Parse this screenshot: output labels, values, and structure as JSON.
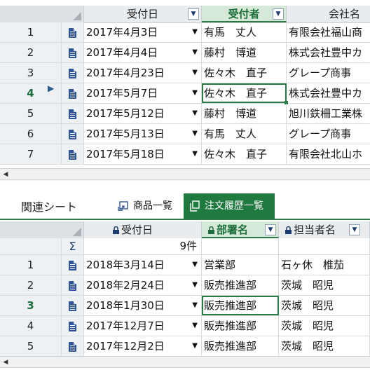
{
  "top_grid": {
    "headers": {
      "date": "受付日",
      "receiver": "受付者",
      "company": "会社名"
    },
    "rows": [
      {
        "num": "1",
        "date": "2017年4月3日",
        "receiver": "有馬　丈人",
        "company": "有限会社福山商"
      },
      {
        "num": "2",
        "date": "2017年4月4日",
        "receiver": "藤村　博道",
        "company": "株式会社豊中カ"
      },
      {
        "num": "3",
        "date": "2017年4月23日",
        "receiver": "佐々木　直子",
        "company": "グレープ商事"
      },
      {
        "num": "4",
        "date": "2017年5月7日",
        "receiver": "佐々木　直子",
        "company": "株式会社豊中カ"
      },
      {
        "num": "5",
        "date": "2017年5月12日",
        "receiver": "藤村　博道",
        "company": "旭川鉄柵工業株"
      },
      {
        "num": "6",
        "date": "2017年5月13日",
        "receiver": "有馬　丈人",
        "company": "グレープ商事"
      },
      {
        "num": "7",
        "date": "2017年5月18日",
        "receiver": "佐々木　直子",
        "company": "有限会社北山ホ"
      }
    ],
    "active_row": 4
  },
  "related": {
    "label": "関連シート",
    "tabs": [
      {
        "label": "商品一覧",
        "icon": "link-sheet-icon"
      },
      {
        "label": "注文履歴一覧",
        "icon": "copy-sheet-icon"
      }
    ],
    "active_tab": 1
  },
  "bottom_grid": {
    "headers": {
      "date": "受付日",
      "dept": "部署名",
      "person": "担当者名"
    },
    "summary": {
      "symbol": "Σ",
      "count": "9件"
    },
    "rows": [
      {
        "num": "1",
        "date": "2018年3月14日",
        "dept": "営業部",
        "person": "石ヶ休　椎茄"
      },
      {
        "num": "2",
        "date": "2018年2月24日",
        "dept": "販売推進部",
        "person": "茨城　昭児"
      },
      {
        "num": "3",
        "date": "2018年1月30日",
        "dept": "販売推進部",
        "person": "茨城　昭児"
      },
      {
        "num": "4",
        "date": "2017年12月7日",
        "dept": "販売推進部",
        "person": "茨城　昭児"
      },
      {
        "num": "5",
        "date": "2017年12月2日",
        "dept": "販売推進部",
        "person": "茨城　昭児"
      }
    ],
    "active_row": 3
  },
  "colors": {
    "accent": "#1f7a40",
    "header_bg": "#e9ecef",
    "icon_blue": "#2f5597"
  }
}
